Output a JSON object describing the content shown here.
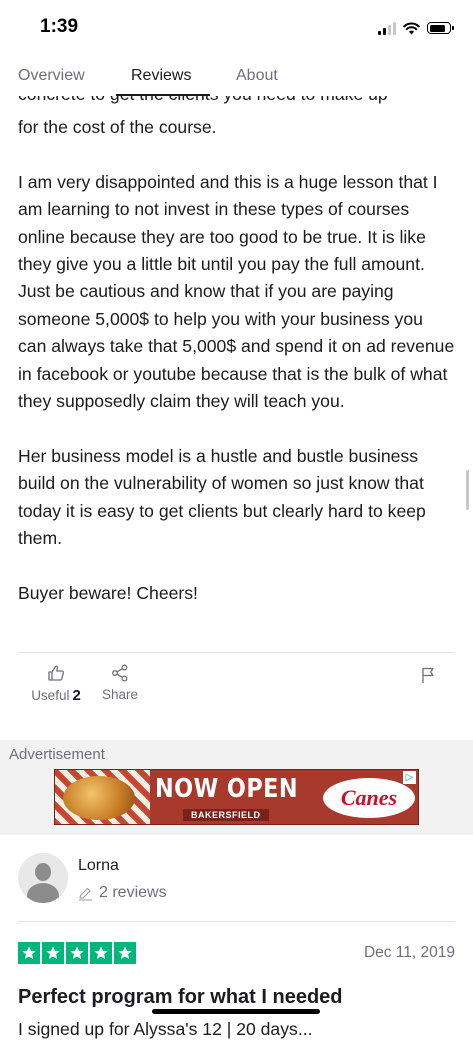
{
  "status_bar": {
    "time": "1:39"
  },
  "tabs": [
    {
      "label": "Overview",
      "active": false
    },
    {
      "label": "Reviews",
      "active": true
    },
    {
      "label": "About",
      "active": false
    }
  ],
  "review": {
    "cut_top_line": "concrete to get the clients you need to make up",
    "paragraphs": [
      "for the cost of the course.",
      "I am very disappointed and this is a huge lesson that I am learning to not invest in these types of courses online because they are too good to be true. It is like they give you a little bit until you pay the full amount. Just be cautious and know that if you are paying someone 5,000$ to help you with your business you can always take that 5,000$ and spend it on ad revenue in facebook or youtube because that is the bulk of what they supposedly claim they will teach you.",
      "Her business model is a hustle and bustle business build on the vulnerability of women so just know that today it is easy to get clients but clearly hard to keep them.",
      "Buyer beware! Cheers!"
    ],
    "actions": {
      "useful_label": "Useful",
      "useful_count": "2",
      "share_label": "Share"
    }
  },
  "advertisement": {
    "label": "Advertisement",
    "headline": "NOW OPEN",
    "location": "BAKERSFIELD",
    "brand": "Canes",
    "ad_choices": "▷"
  },
  "next_review": {
    "reviewer_name": "Lorna",
    "reviews_count": "2 reviews",
    "rating": 5,
    "date": "Dec 11, 2019",
    "title": "Perfect program for what I needed",
    "next_line": "I signed up for Alyssa's 12 | 20 days..."
  },
  "colors": {
    "star_green": "#00b67a",
    "text_primary": "#1b1b21",
    "text_muted": "#6f6f7f",
    "ad_background": "#f2f2f2"
  }
}
